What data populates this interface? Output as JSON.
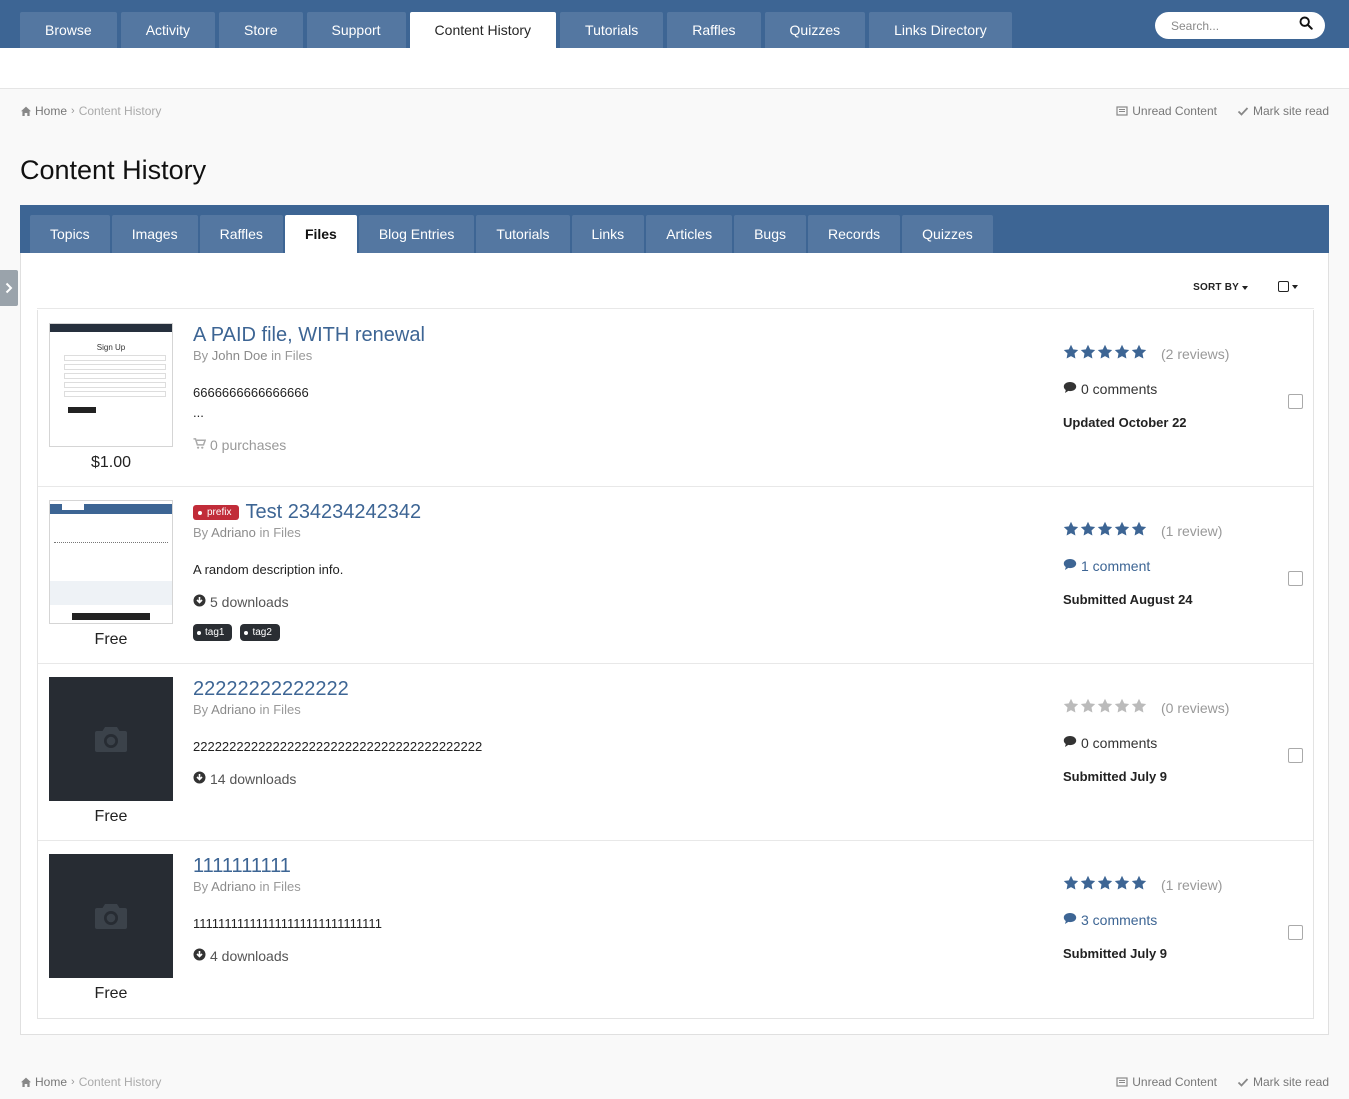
{
  "topnav": {
    "tabs": [
      {
        "label": "Browse",
        "active": false
      },
      {
        "label": "Activity",
        "active": false
      },
      {
        "label": "Store",
        "active": false
      },
      {
        "label": "Support",
        "active": false
      },
      {
        "label": "Content History",
        "active": true
      },
      {
        "label": "Tutorials",
        "active": false
      },
      {
        "label": "Raffles",
        "active": false
      },
      {
        "label": "Quizzes",
        "active": false
      },
      {
        "label": "Links Directory",
        "active": false
      }
    ],
    "search_placeholder": "Search..."
  },
  "breadcrumb": {
    "home": "Home",
    "current": "Content History",
    "unread": "Unread Content",
    "mark_read": "Mark site read"
  },
  "page": {
    "title": "Content History",
    "sort_by": "SORT BY"
  },
  "section_tabs": [
    {
      "label": "Topics",
      "active": false
    },
    {
      "label": "Images",
      "active": false
    },
    {
      "label": "Raffles",
      "active": false
    },
    {
      "label": "Files",
      "active": true
    },
    {
      "label": "Blog Entries",
      "active": false
    },
    {
      "label": "Tutorials",
      "active": false
    },
    {
      "label": "Links",
      "active": false
    },
    {
      "label": "Articles",
      "active": false
    },
    {
      "label": "Bugs",
      "active": false
    },
    {
      "label": "Records",
      "active": false
    },
    {
      "label": "Quizzes",
      "active": false
    }
  ],
  "files": [
    {
      "title": "A PAID file, WITH renewal",
      "prefix": "",
      "by": "By",
      "author": "John Doe",
      "in": "in Files",
      "description": "6666666666666666\n...",
      "meta": "0 purchases",
      "meta_icon": "cart-icon",
      "price": "$1.00",
      "thumb": "screenshot",
      "thumb_title": "Sign Up",
      "rating": 5,
      "reviews": "(2 reviews)",
      "comments": "0 comments",
      "comments_link": false,
      "date": "Updated October 22",
      "tags": []
    },
    {
      "title": "Test 234234242342",
      "prefix": "prefix",
      "by": "By",
      "author": "Adriano",
      "in": "in Files",
      "description": "A random description info.",
      "meta": "5 downloads",
      "meta_icon": "download-icon",
      "price": "Free",
      "thumb": "screenshot2",
      "rating": 5,
      "reviews": "(1 review)",
      "comments": "1 comment",
      "comments_link": true,
      "date": "Submitted August 24",
      "tags": [
        "tag1",
        "tag2"
      ]
    },
    {
      "title": "22222222222222",
      "prefix": "",
      "by": "By",
      "author": "Adriano",
      "in": "in Files",
      "description": "2222222222222222222222222222222222222222",
      "meta": "14 downloads",
      "meta_icon": "download-icon",
      "price": "Free",
      "thumb": "camera",
      "rating": 0,
      "reviews": "(0 reviews)",
      "comments": "0 comments",
      "comments_link": false,
      "date": "Submitted July 9",
      "tags": []
    },
    {
      "title": "1111111111",
      "prefix": "",
      "by": "By",
      "author": "Adriano",
      "in": "in Files",
      "description": "111111111111111111111111111111",
      "meta": "4 downloads",
      "meta_icon": "download-icon",
      "price": "Free",
      "thumb": "camera",
      "rating": 5,
      "reviews": "(1 review)",
      "comments": "3 comments",
      "comments_link": true,
      "date": "Submitted July 9",
      "tags": []
    }
  ],
  "colors": {
    "brand": "#3d6594",
    "star_on": "#3d6594",
    "star_off": "#bbbbbb",
    "prefix": "#c12c39",
    "tag": "#2a2e33"
  }
}
